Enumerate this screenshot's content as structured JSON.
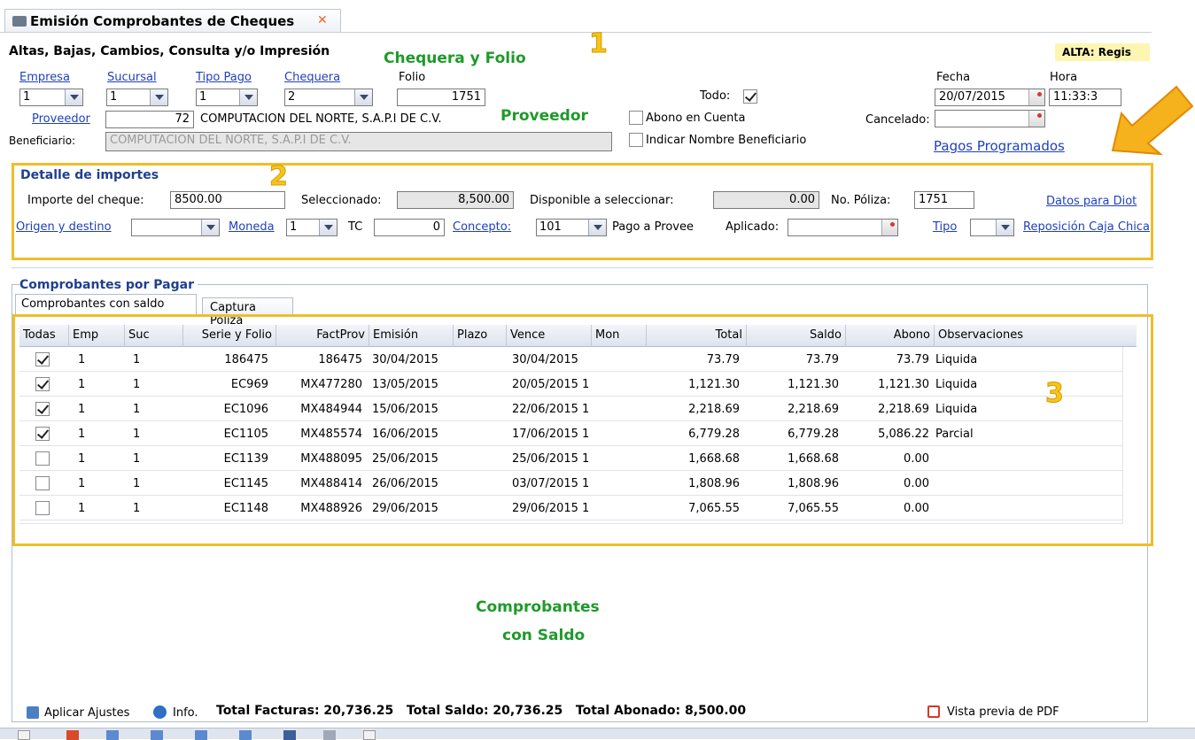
{
  "tab": {
    "title": "Emisión Comprobantes de Cheques",
    "close_glyph": "✕"
  },
  "header": {
    "subtitle": "Altas, Bajas, Cambios, Consulta y/o Impresión",
    "mode_badge": "ALTA: Regis"
  },
  "annotations": {
    "chequera_folio": "Chequera y Folio",
    "proveedor": "Proveedor",
    "comprobantes_line1": "Comprobantes",
    "comprobantes_line2": "con Saldo",
    "n1": "1",
    "n2": "2",
    "n3": "3"
  },
  "form": {
    "empresa_label": "Empresa",
    "empresa_value": "1",
    "sucursal_label": "Sucursal",
    "sucursal_value": "1",
    "tipo_pago_label": "Tipo Pago",
    "tipo_pago_value": "1",
    "chequera_label": "Chequera",
    "chequera_value": "2",
    "folio_label": "Folio",
    "folio_value": "1751",
    "todo_label": "Todo:",
    "fecha_label": "Fecha",
    "fecha_value": "20/07/2015",
    "hora_label": "Hora",
    "hora_value": "11:33:3",
    "proveedor_label": "Proveedor",
    "proveedor_value": "72",
    "proveedor_name": "COMPUTACION DEL NORTE, S.A.P.I DE C.V.",
    "abono_cuenta_label": "Abono en Cuenta",
    "cancelado_label": "Cancelado:",
    "beneficiario_label": "Beneficiario:",
    "beneficiario_value": "COMPUTACION DEL NORTE, S.A.P.I DE C.V.",
    "indicar_nombre_label": "Indicar Nombre Beneficiario",
    "pagos_programados": "Pagos Programados"
  },
  "detalle": {
    "legend": "Detalle de importes",
    "importe_label": "Importe del cheque:",
    "importe_value": "8500.00",
    "seleccionado_label": "Seleccionado:",
    "seleccionado_value": "8,500.00",
    "disponible_label": "Disponible a seleccionar:",
    "disponible_value": "0.00",
    "poliza_label": "No. Póliza:",
    "poliza_value": "1751",
    "datos_diot": "Datos para Diot",
    "origen_label": "Origen y destino",
    "origen_value": "",
    "moneda_label": "Moneda",
    "moneda_value": "1",
    "tc_label": "TC",
    "tc_value": "0",
    "concepto_label": "Concepto:",
    "concepto_value": "101",
    "concepto_desc": "Pago a Provee",
    "aplicado_label": "Aplicado:",
    "aplicado_value": "",
    "tipo_label": "Tipo",
    "tipo_value": "",
    "reposicion": "Reposición Caja Chica"
  },
  "comprobantes": {
    "legend": "Comprobantes por Pagar",
    "tabs": [
      "Comprobantes con saldo",
      "Captura Póliza"
    ],
    "columns": [
      "Todas",
      "Emp",
      "Suc",
      "Serie y Folio",
      "FactProv",
      "Emisión",
      "Plazo",
      "Vence",
      "Mon",
      "Total",
      "Saldo",
      "Abono",
      "Observaciones"
    ],
    "rows": [
      {
        "checked": true,
        "emp": "1",
        "suc": "1",
        "serie": "186475",
        "fact": "186475",
        "emision": "30/04/2015",
        "plazo": "",
        "vence": "30/04/2015",
        "mon": "",
        "total": "73.79",
        "saldo": "73.79",
        "abono": "73.79",
        "obs": "Liquida"
      },
      {
        "checked": true,
        "emp": "1",
        "suc": "1",
        "serie": "EC969",
        "fact": "MX477280",
        "emision": "13/05/2015",
        "plazo": "",
        "vence": "20/05/2015 1",
        "mon": "",
        "total": "1,121.30",
        "saldo": "1,121.30",
        "abono": "1,121.30",
        "obs": "Liquida"
      },
      {
        "checked": true,
        "emp": "1",
        "suc": "1",
        "serie": "EC1096",
        "fact": "MX484944",
        "emision": "15/06/2015",
        "plazo": "",
        "vence": "22/06/2015 1",
        "mon": "",
        "total": "2,218.69",
        "saldo": "2,218.69",
        "abono": "2,218.69",
        "obs": "Liquida"
      },
      {
        "checked": true,
        "emp": "1",
        "suc": "1",
        "serie": "EC1105",
        "fact": "MX485574",
        "emision": "16/06/2015",
        "plazo": "",
        "vence": "17/06/2015 1",
        "mon": "",
        "total": "6,779.28",
        "saldo": "6,779.28",
        "abono": "5,086.22",
        "obs": "Parcial"
      },
      {
        "checked": false,
        "emp": "1",
        "suc": "1",
        "serie": "EC1139",
        "fact": "MX488095",
        "emision": "25/06/2015",
        "plazo": "",
        "vence": "25/06/2015 1",
        "mon": "",
        "total": "1,668.68",
        "saldo": "1,668.68",
        "abono": "0.00",
        "obs": ""
      },
      {
        "checked": false,
        "emp": "1",
        "suc": "1",
        "serie": "EC1145",
        "fact": "MX488414",
        "emision": "26/06/2015",
        "plazo": "",
        "vence": "03/07/2015 1",
        "mon": "",
        "total": "1,808.96",
        "saldo": "1,808.96",
        "abono": "0.00",
        "obs": ""
      },
      {
        "checked": false,
        "emp": "1",
        "suc": "1",
        "serie": "EC1148",
        "fact": "MX488926",
        "emision": "29/06/2015",
        "plazo": "",
        "vence": "29/06/2015 1",
        "mon": "",
        "total": "7,065.55",
        "saldo": "7,065.55",
        "abono": "0.00",
        "obs": ""
      }
    ]
  },
  "footer": {
    "aplicar": "Aplicar Ajustes",
    "info": "Info.",
    "totales": "Total Facturas: 20,736.25   Total Saldo: 20,736.25   Total Abonado: 8,500.00",
    "vista_pdf": "Vista previa de PDF"
  },
  "colors": {
    "accent_panel": "#f0bd2a",
    "link": "#1f3fbf",
    "annotation": "#1e9a2a"
  }
}
